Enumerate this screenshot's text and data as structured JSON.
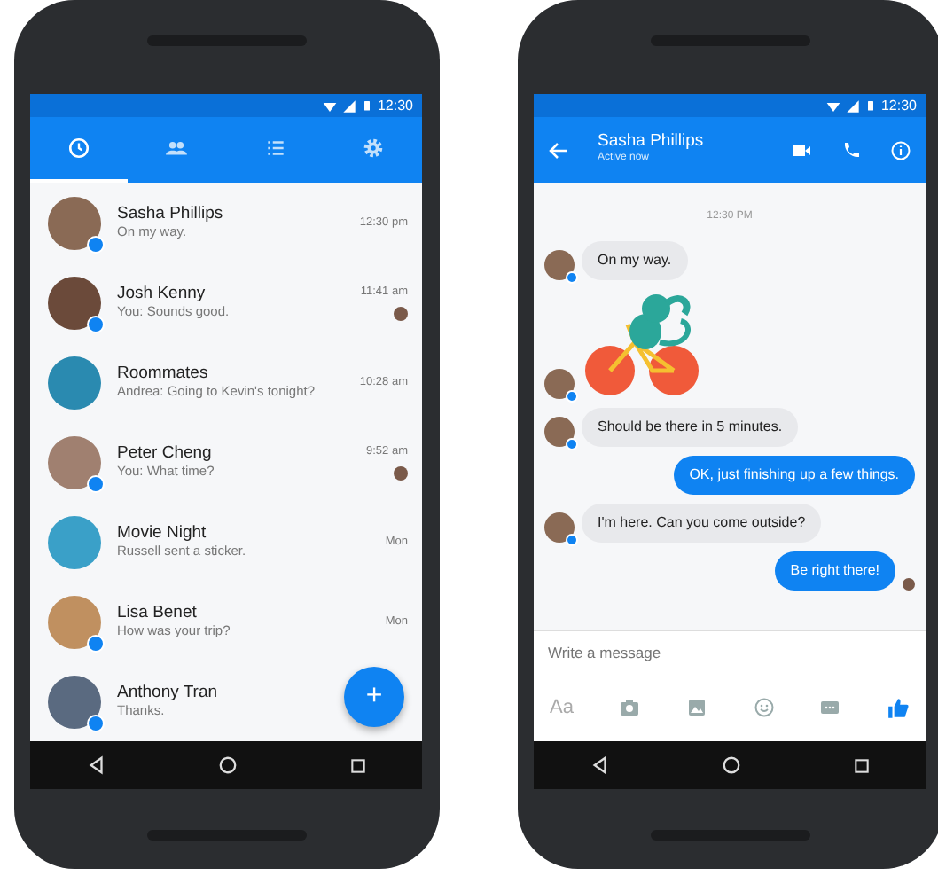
{
  "left_phone": {
    "status_bar": {
      "time": "12:30"
    },
    "tabs": [
      {
        "selected": true
      },
      {
        "selected": false
      },
      {
        "selected": false
      },
      {
        "selected": false
      }
    ],
    "conversations": [
      {
        "name": "Sasha Phillips",
        "preview": "On my way.",
        "time": "12:30 pm",
        "badge": true,
        "seen_avatar": false
      },
      {
        "name": "Josh Kenny",
        "preview": "You: Sounds good.",
        "time": "11:41 am",
        "badge": true,
        "seen_avatar": true
      },
      {
        "name": "Roommates",
        "preview": "Andrea: Going to Kevin's tonight?",
        "time": "10:28 am",
        "badge": false,
        "seen_avatar": false
      },
      {
        "name": "Peter Cheng",
        "preview": "You: What time?",
        "time": "9:52 am",
        "badge": true,
        "seen_avatar": true
      },
      {
        "name": "Movie Night",
        "preview": "Russell sent a sticker.",
        "time": "Mon",
        "badge": false,
        "seen_avatar": false
      },
      {
        "name": "Lisa Benet",
        "preview": "How was your trip?",
        "time": "Mon",
        "badge": true,
        "seen_avatar": false
      },
      {
        "name": "Anthony Tran",
        "preview": "Thanks.",
        "badge": true,
        "seen_avatar": false
      }
    ],
    "fab": "+"
  },
  "right_phone": {
    "status_bar": {
      "time": "12:30"
    },
    "header": {
      "title": "Sasha Phillips",
      "subtitle": "Active now"
    },
    "timestamp": "12:30 PM",
    "messages": [
      {
        "kind": "text",
        "text": "On my way.",
        "outgoing": false,
        "avatar": true,
        "seen_avatar": false
      },
      {
        "kind": "sticker",
        "outgoing": false,
        "avatar": true,
        "seen_avatar": false
      },
      {
        "kind": "text",
        "text": "Should be there in 5 minutes.",
        "outgoing": false,
        "avatar": true,
        "seen_avatar": false
      },
      {
        "kind": "text",
        "text": "OK, just finishing up a few things.",
        "outgoing": true,
        "avatar": false,
        "seen_avatar": false
      },
      {
        "kind": "text",
        "text": "I'm here. Can you come outside?",
        "outgoing": false,
        "avatar": true,
        "seen_avatar": false
      },
      {
        "kind": "text",
        "text": "Be right there!",
        "outgoing": true,
        "avatar": false,
        "seen_avatar": true
      }
    ],
    "composer": {
      "placeholder": "Write a message"
    },
    "toolbar": {
      "text_button": "Aa"
    }
  }
}
